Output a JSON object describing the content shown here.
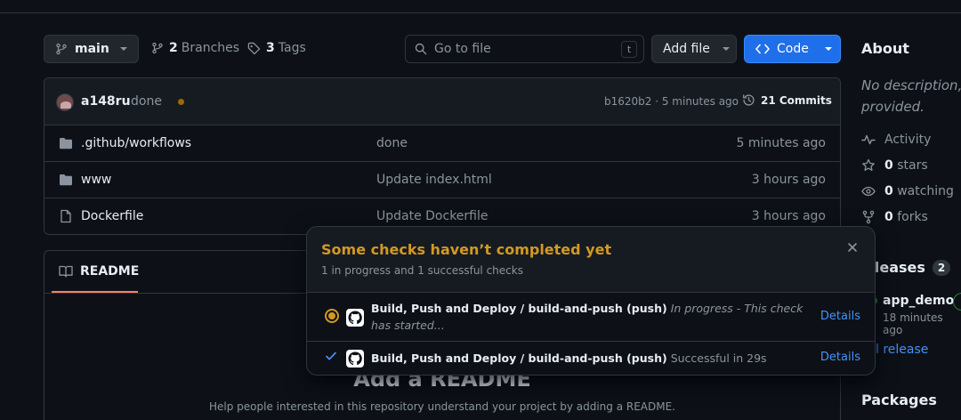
{
  "toolbar": {
    "branch": "main",
    "branches_count": "2",
    "branches_label": "Branches",
    "tags_count": "3",
    "tags_label": "Tags",
    "search_placeholder": "Go to file",
    "search_shortcut": "t",
    "add_file": "Add file",
    "code": "Code"
  },
  "commit": {
    "author": "a148ru",
    "message": "done",
    "hash_time": "b1620b2 · 5 minutes ago",
    "commits": "21 Commits",
    "status_color": "#9e6a03"
  },
  "files": [
    {
      "icon": "folder-icon",
      "name": ".github/workflows",
      "message": "done",
      "time": "5 minutes ago"
    },
    {
      "icon": "folder-icon",
      "name": "www",
      "message": "Update index.html",
      "time": "3 hours ago"
    },
    {
      "icon": "file-icon",
      "name": "Dockerfile",
      "message": "Update Dockerfile",
      "time": "3 hours ago"
    }
  ],
  "readme": {
    "tab": "README",
    "title": "Add a README",
    "subtitle": "Help people interested in this repository understand your project by adding a README."
  },
  "about": {
    "title": "About",
    "description": "No description, provided.",
    "activity": "Activity",
    "stars_count": "0",
    "stars_label": "stars",
    "watching_count": "0",
    "watching_label": "watching",
    "forks_count": "0",
    "forks_label": "forks"
  },
  "releases": {
    "title": "eleases",
    "count": "2",
    "name": "app_demo",
    "time": "18 minutes ago",
    "link": "l release"
  },
  "packages": {
    "title": "Packages"
  },
  "checks_popup": {
    "title": "Some checks haven’t completed yet",
    "subtitle": "1 in progress and 1 successful checks",
    "checks": [
      {
        "name": "Build, Push and Deploy / build-and-push (push)",
        "status": "In progress - This check has started...",
        "state": "in-progress",
        "details": "Details"
      },
      {
        "name": "Build, Push and Deploy / build-and-push (push)",
        "status": "Successful in 29s",
        "state": "success",
        "details": "Details"
      }
    ],
    "accent": "#d29922",
    "link_color": "#4493f8"
  }
}
